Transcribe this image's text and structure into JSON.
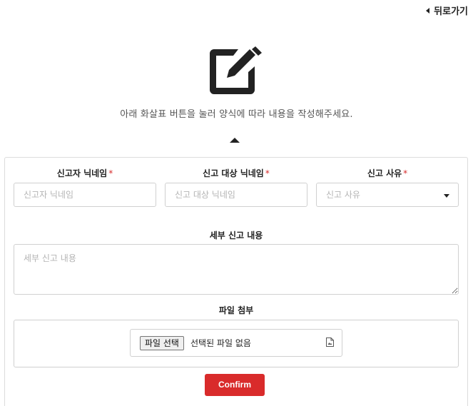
{
  "header": {
    "back_label": "뒤로가기"
  },
  "hero": {
    "icon": "edit-icon",
    "instruction": "아래 화살표 버튼을 눌러 양식에 따라 내용을 작성해주세요.",
    "toggle_icon": "caret-up-icon"
  },
  "form": {
    "reporter": {
      "label": "신고자 닉네임",
      "required_mark": "*",
      "placeholder": "신고자 닉네임",
      "value": ""
    },
    "target": {
      "label": "신고 대상 닉네임",
      "required_mark": "*",
      "placeholder": "신고 대상 닉네임",
      "value": ""
    },
    "reason": {
      "label": "신고 사유",
      "required_mark": "*",
      "placeholder": "신고 사유",
      "selected": ""
    },
    "details": {
      "label": "세부 신고 내용",
      "placeholder": "세부 신고 내용",
      "value": ""
    },
    "attachment": {
      "label": "파일 첨부",
      "button_label": "파일 선택",
      "status": "선택된 파일 없음",
      "icon": "file-icon"
    },
    "confirm_label": "Confirm"
  },
  "colors": {
    "accent": "#d92b2b",
    "required": "#d62a2a",
    "border": "#d0d0d0"
  }
}
